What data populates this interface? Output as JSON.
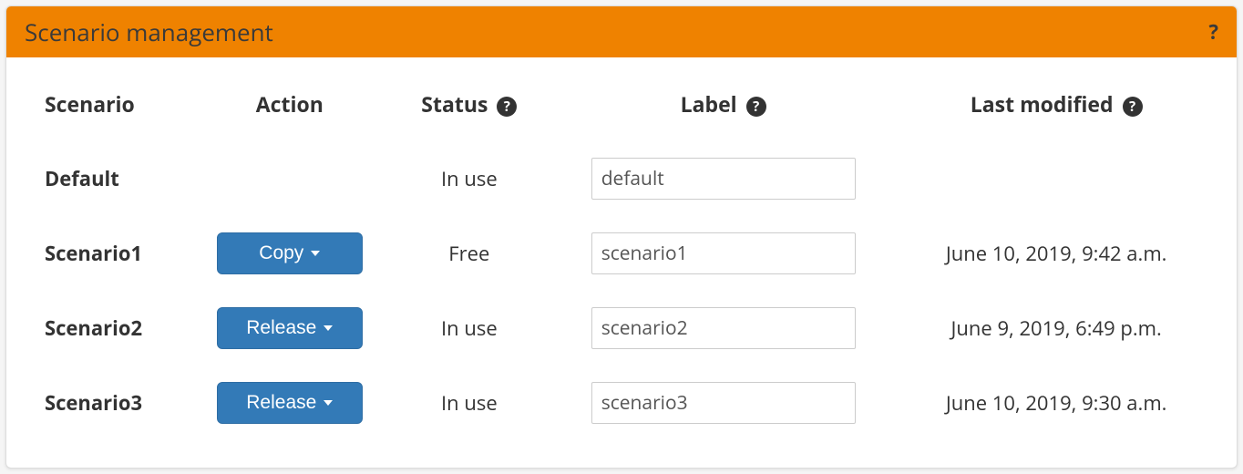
{
  "panel": {
    "title": "Scenario management",
    "help": "?"
  },
  "headers": {
    "scenario": "Scenario",
    "action": "Action",
    "status": "Status",
    "label": "Label",
    "last_modified": "Last modified"
  },
  "help_glyph": "?",
  "rows": [
    {
      "name": "Default",
      "action": "",
      "status": "In use",
      "label": "default",
      "last_modified": ""
    },
    {
      "name": "Scenario1",
      "action": "Copy",
      "status": "Free",
      "label": "scenario1",
      "last_modified": "June 10, 2019, 9:42 a.m."
    },
    {
      "name": "Scenario2",
      "action": "Release",
      "status": "In use",
      "label": "scenario2",
      "last_modified": "June 9, 2019, 6:49 p.m."
    },
    {
      "name": "Scenario3",
      "action": "Release",
      "status": "In use",
      "label": "scenario3",
      "last_modified": "June 10, 2019, 9:30 a.m."
    }
  ]
}
